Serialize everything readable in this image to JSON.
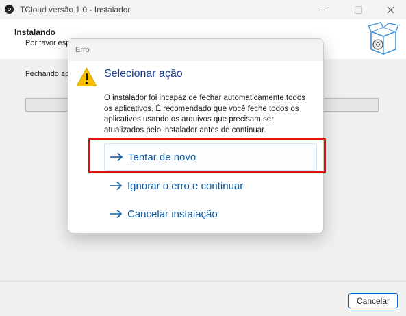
{
  "window": {
    "title": "TCloud versão 1.0 - Instalador"
  },
  "installer": {
    "heading": "Instalando",
    "subheading": "Por favor esp",
    "status": "Fechando apl",
    "progress": 0,
    "cancel_label": "Cancelar"
  },
  "dialog": {
    "title": "Erro",
    "heading": "Selecionar ação",
    "message": "O instalador foi incapaz de fechar automaticamente todos os aplicativos. É recomendado que você feche todos os aplicativos usando os arquivos que precisam ser atualizados pelo instalador antes de continuar.",
    "commands": [
      {
        "label": "Tentar de novo"
      },
      {
        "label": "Ignorar o erro e continuar"
      },
      {
        "label": "Cancelar instalação"
      }
    ]
  },
  "icons": {
    "app": "tcloud-logo-icon",
    "warning": "warning-icon",
    "command": "arrow-right-icon",
    "installer_logo": "software-box-icon"
  },
  "colors": {
    "accent": "#0067c0",
    "link": "#0a5aa6",
    "heading": "#1b3f8f",
    "highlight": "#e01010",
    "warning": "#f4c000"
  }
}
